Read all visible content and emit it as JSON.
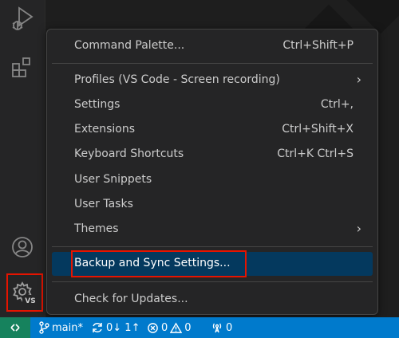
{
  "menu": {
    "items": [
      {
        "label": "Command Palette...",
        "shortcut": "Ctrl+Shift+P"
      },
      {
        "label": "Profiles (VS Code - Screen recording)",
        "shortcut": ""
      },
      {
        "label": "Settings",
        "shortcut": "Ctrl+,"
      },
      {
        "label": "Extensions",
        "shortcut": "Ctrl+Shift+X"
      },
      {
        "label": "Keyboard Shortcuts",
        "shortcut": "Ctrl+K Ctrl+S"
      },
      {
        "label": "User Snippets",
        "shortcut": ""
      },
      {
        "label": "User Tasks",
        "shortcut": ""
      },
      {
        "label": "Themes",
        "shortcut": ""
      },
      {
        "label": "Backup and Sync Settings...",
        "shortcut": ""
      },
      {
        "label": "Check for Updates...",
        "shortcut": ""
      }
    ],
    "active_item": "Backup and Sync Settings...",
    "submenu_items": [
      "Profiles (VS Code - Screen recording)",
      "Themes"
    ]
  },
  "activity_bar": {
    "icons": [
      "run-and-debug-icon",
      "extensions-icon",
      "account-icon",
      "manage-gear-icon"
    ],
    "manage_badge": "VS"
  },
  "statusbar": {
    "branch": "main*",
    "sync": "0↓ 1↑",
    "errors": "0",
    "warnings": "0",
    "ports": "0"
  },
  "colors": {
    "statusbar": "#007acc",
    "remote": "#16825d",
    "menu_bg": "#252526",
    "menu_active": "#04395e",
    "highlight": "#e51400"
  }
}
